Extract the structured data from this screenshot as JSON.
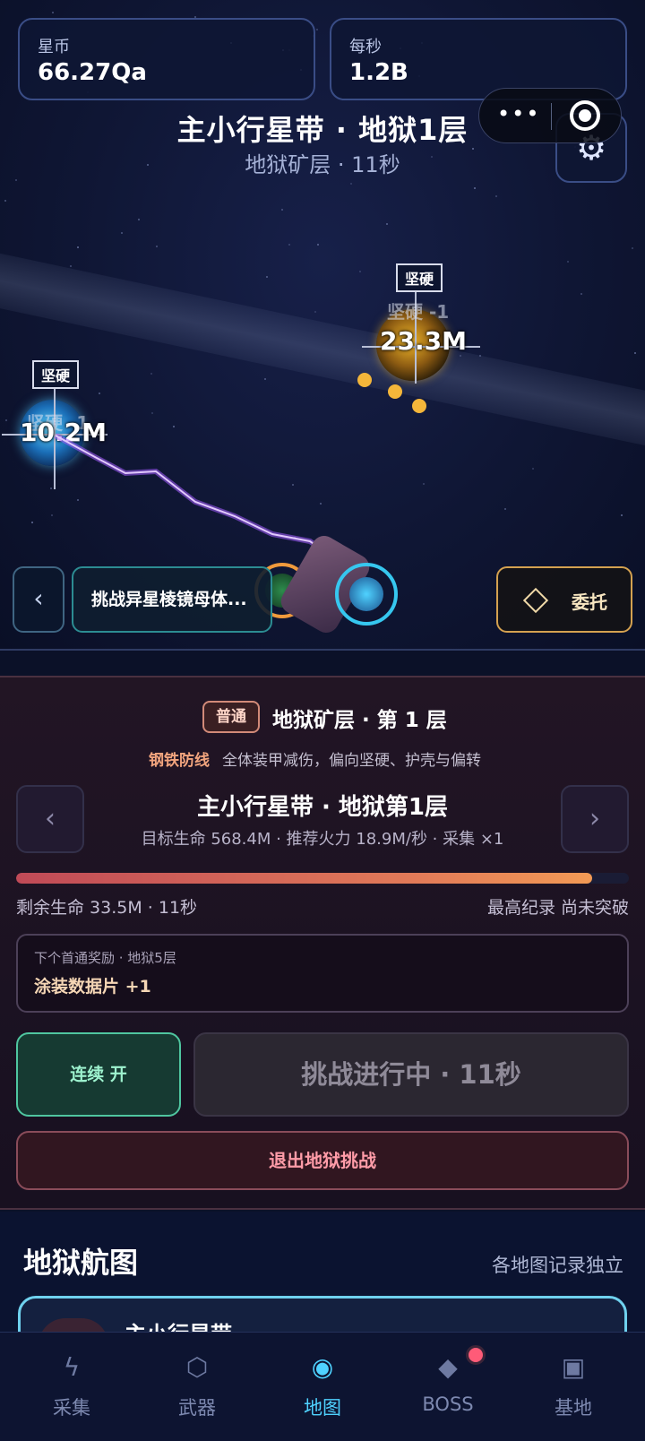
{
  "stats": {
    "coins_label": "星币",
    "coins_value": "66.27Qa",
    "rate_label": "每秒",
    "rate_value": "1.2B"
  },
  "header": {
    "title": "主小行星带 · 地狱1层",
    "subtitle": "地狱矿层 · 11秒"
  },
  "targets": [
    {
      "tag": "坚硬",
      "hp": "23.3M",
      "ghost": "坚硬 -1"
    },
    {
      "tag": "坚硬",
      "hp": "10.2M",
      "ghost": "坚硬 -1"
    }
  ],
  "actions": {
    "back_symbol": "‹",
    "challenge_label": "挑战异星棱镜母体...",
    "entrust_label": "委托"
  },
  "panel": {
    "badge": "普通",
    "layer_title": "地狱矿层 · 第 1 层",
    "modifier_name": "钢铁防线",
    "modifier_desc": "全体装甲减伤，偏向坚硬、护壳与偏转",
    "prev_symbol": "‹",
    "next_symbol": "›",
    "stage_name": "主小行星带 · 地狱第1层",
    "stage_info": "目标生命 568.4M · 推荐火力 18.9M/秒 · 采集 ×1",
    "hp_progress": 0.94,
    "hp_remaining": "剩余生命 33.5M · 11秒",
    "best_record": "最高纪录 尚未突破",
    "reward_label": "下个首通奖励 · 地狱5层",
    "reward_value": "涂装数据片 +1",
    "loop_label": "连续 开",
    "progress_label": "挑战进行中 · 11秒",
    "exit_label": "退出地狱挑战"
  },
  "map": {
    "title": "地狱航图",
    "note": "各地图记录独立",
    "card_title": "主小行星带"
  },
  "nav": [
    {
      "label": "采集",
      "icon": "lightning-icon",
      "glyph": "ϟ",
      "active": false
    },
    {
      "label": "武器",
      "icon": "hexagon-icon",
      "glyph": "⬡",
      "active": false
    },
    {
      "label": "地图",
      "icon": "map-dot-icon",
      "glyph": "◉",
      "active": true
    },
    {
      "label": "BOSS",
      "icon": "diamond-icon",
      "glyph": "◆",
      "active": false
    },
    {
      "label": "基地",
      "icon": "base-square-icon",
      "glyph": "▣",
      "active": false
    }
  ],
  "colors": {
    "accent": "#4fd2ff",
    "hp_bar_start": "#c04a57",
    "hp_bar_end": "#f29a55",
    "loop_green": "#4fc6a0",
    "exit_red": "#ff9ca8"
  }
}
